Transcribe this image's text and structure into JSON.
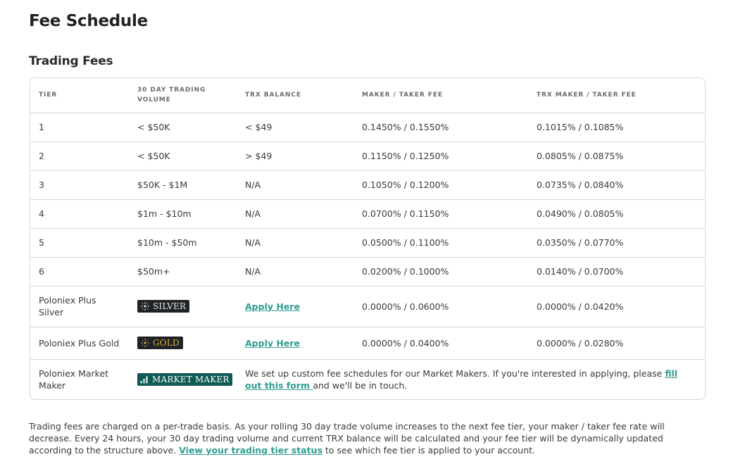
{
  "page": {
    "title": "Fee Schedule",
    "section_title": "Trading Fees"
  },
  "table": {
    "headers": [
      "TIER",
      "30 DAY TRADING VOLUME",
      "TRX BALANCE",
      "MAKER / TAKER FEE",
      "TRX MAKER / TAKER FEE"
    ],
    "rows": [
      {
        "tier": "1",
        "volume": "< $50K",
        "trx": "< $49",
        "fee": "0.1450% / 0.1550%",
        "trx_fee": "0.1015% / 0.1085%"
      },
      {
        "tier": "2",
        "volume": "< $50K",
        "trx": "> $49",
        "fee": "0.1150% / 0.1250%",
        "trx_fee": "0.0805% / 0.0875%"
      },
      {
        "tier": "3",
        "volume": "$50K - $1M",
        "trx": "N/A",
        "fee": "0.1050% / 0.1200%",
        "trx_fee": "0.0735% / 0.0840%"
      },
      {
        "tier": "4",
        "volume": "$1m - $10m",
        "trx": "N/A",
        "fee": "0.0700% / 0.1150%",
        "trx_fee": "0.0490% / 0.0805%"
      },
      {
        "tier": "5",
        "volume": "$10m - $50m",
        "trx": "N/A",
        "fee": "0.0500% / 0.1100%",
        "trx_fee": "0.0350% / 0.0770%"
      },
      {
        "tier": "6",
        "volume": "$50m+",
        "trx": "N/A",
        "fee": "0.0200% / 0.1000%",
        "trx_fee": "0.0140% / 0.0700%"
      }
    ],
    "silver": {
      "tier": "Poloniex Plus Silver",
      "badge": "SILVER",
      "badge_icon": "sparkle-icon",
      "link": "Apply Here",
      "fee": "0.0000% / 0.0600%",
      "trx_fee": "0.0000% / 0.0420%"
    },
    "gold": {
      "tier": "Poloniex Plus Gold",
      "badge": "GOLD",
      "badge_icon": "sparkle-icon",
      "link": "Apply Here",
      "fee": "0.0000% / 0.0400%",
      "trx_fee": "0.0000% / 0.0280%"
    },
    "market_maker": {
      "tier": "Poloniex Market Maker",
      "badge": "MARKET MAKER",
      "badge_icon": "bar-chart-icon",
      "text_before": "We set up custom fee schedules for our Market Makers. If you're interested in applying, please ",
      "link": "fill out this form ",
      "text_after": "and we'll be in touch."
    }
  },
  "footnote": {
    "text_before": "Trading fees are charged on a per-trade basis. As your rolling 30 day trade volume increases to the next fee tier, your maker / taker fee rate will decrease. Every 24 hours, your 30 day trading volume and current TRX balance will be calculated and your fee tier will be dynamically updated according to the structure above. ",
    "link": "View your trading tier status",
    "text_after": " to see which fee tier is applied to your account."
  },
  "colors": {
    "link": "#2f9d91",
    "silver_badge_bg": "#1f2326",
    "gold_badge_text": "#d9a93a",
    "market_maker_badge_bg": "#0f5a55",
    "border": "#d6d6d6"
  }
}
